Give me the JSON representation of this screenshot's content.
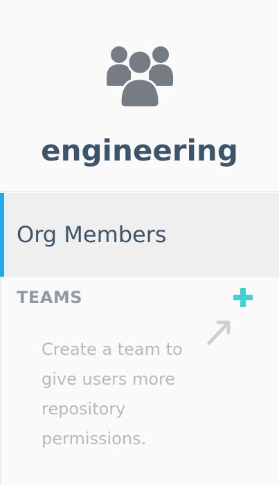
{
  "org": {
    "name": "engineering",
    "icon": "users-group-icon"
  },
  "nav": {
    "items": [
      {
        "label": "Org Members",
        "selected": true
      }
    ]
  },
  "teams": {
    "heading": "TEAMS",
    "add_icon": "plus-icon",
    "empty_message": "Create a team to give users more repository permissions.",
    "hint_icon": "arrow-up-right-icon"
  },
  "colors": {
    "accent": "#29a8e6",
    "plus": "#3dd3cf",
    "title": "#3e5468",
    "heading": "#8f9ba3",
    "muted": "#b9b9b9"
  }
}
